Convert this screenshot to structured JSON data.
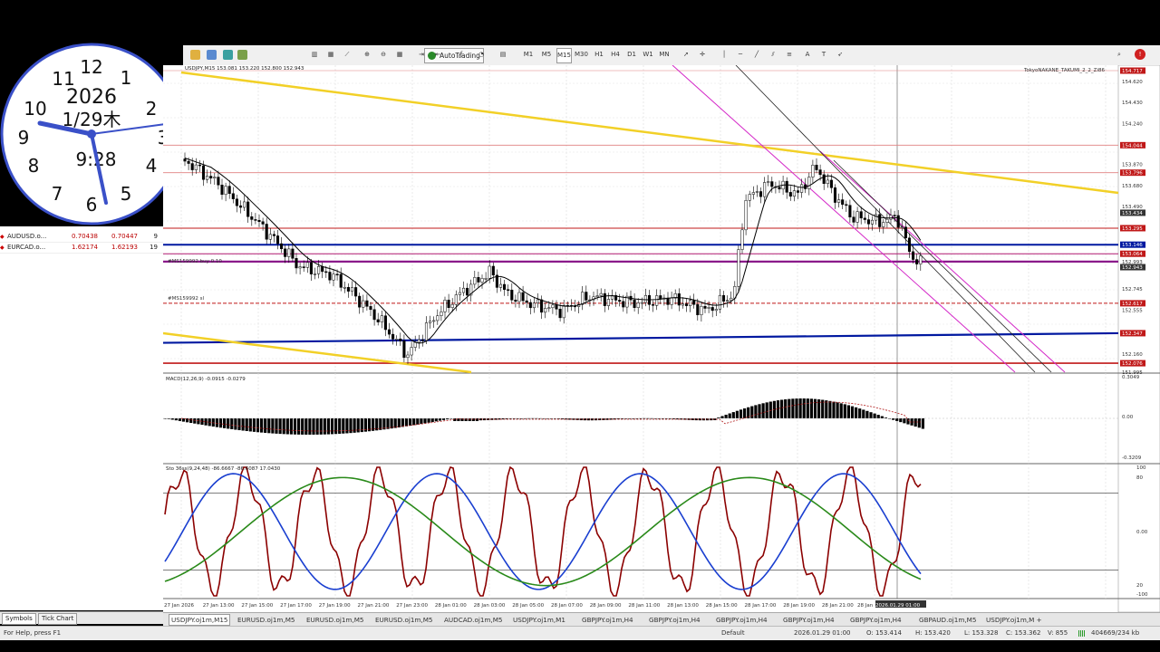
{
  "clock": {
    "year": "2026",
    "date": "1/29木",
    "time": "9:28",
    "numerals": [
      "12",
      "1",
      "2",
      "3",
      "4",
      "5",
      "6",
      "7",
      "8",
      "9",
      "10",
      "11"
    ]
  },
  "market_watch": {
    "rows": [
      {
        "symbol": "AUDUSD.o...",
        "bid": "0.70438",
        "ask": "0.70447",
        "spread": "9"
      },
      {
        "symbol": "EURCAD.o...",
        "bid": "1.62174",
        "ask": "1.62193",
        "spread": "19"
      }
    ],
    "tabs": [
      "Symbols",
      "Tick Chart"
    ]
  },
  "toolbar": {
    "autotrading_label": "AutoTrading",
    "timeframes": [
      "M1",
      "M5",
      "M15",
      "M30",
      "H1",
      "H4",
      "D1",
      "W1",
      "MN"
    ],
    "active_timeframe": "M15"
  },
  "chart": {
    "header": "USDJPY,M15 153.081 153.220 152.800 152.943",
    "top_right_label": "TokyoNAKANE_TAKUMI_2_2_Zi86",
    "hline_label_1": "#MS159992 buy 0.10",
    "hline_label_2": "#MS159992 sl",
    "price_scale": [
      "154.717",
      "154.620",
      "154.430",
      "154.240",
      "154.044",
      "153.870",
      "153.796",
      "153.680",
      "153.490",
      "153.434",
      "153.295",
      "153.146",
      "153.064",
      "152.993",
      "152.943",
      "152.745",
      "152.617",
      "152.555",
      "152.347",
      "152.160",
      "152.076",
      "151.995"
    ],
    "macd_label": "MACD(12,26,9) -0.0915 -0.0279",
    "macd_scale": [
      "0.3049",
      "0.00",
      "-0.3209"
    ],
    "stoch_label": "Sto 36ss(9,24,48) -86.6667 -86.6087 17.0430",
    "stoch_scale": [
      "100",
      "80",
      "0.00",
      "20",
      "-100"
    ],
    "time_axis": [
      "27 Jan 2026",
      "27 Jan 13:00",
      "27 Jan 15:00",
      "27 Jan 17:00",
      "27 Jan 19:00",
      "27 Jan 21:00",
      "27 Jan 23:00",
      "28 Jan 01:00",
      "28 Jan 03:00",
      "28 Jan 05:00",
      "28 Jan 07:00",
      "28 Jan 09:00",
      "28 Jan 11:00",
      "28 Jan 13:00",
      "28 Jan 15:00",
      "28 Jan 17:00",
      "28 Jan 19:00",
      "28 Jan 21:00",
      "28 Jan",
      "2026.01.29 01:00"
    ]
  },
  "chart_tabs": {
    "tabs": [
      "USDJPY.oj1m,M15",
      "EURUSD.oj1m,M5",
      "EURUSD.oj1m,M5",
      "EURUSD.oj1m,M5",
      "AUDCAD.oj1m,M5",
      "USDJPY.oj1m,M1",
      "GBPJPY.oj1m,H4",
      "GBPJPY.oj1m,H4",
      "GBPJPY.oj1m,H4",
      "GBPJPY.oj1m,H4",
      "GBPJPY.oj1m,H4",
      "GBPAUD.oj1m,M5",
      "USDJPY.oj1m,M +"
    ],
    "active_index": 0
  },
  "status": {
    "help": "For Help, press F1",
    "profile": "Default",
    "datetime": "2026.01.29 01:00",
    "open": "O: 153.414",
    "high": "H: 153.420",
    "low": "L: 153.328",
    "close": "C: 153.362",
    "volume": "V: 855",
    "traffic": "404669/234 kb"
  },
  "colors": {
    "bull_candle": "#ffffff",
    "bear_candle": "#000000",
    "trendline_yellow": "#f2d027",
    "channel_magenta": "#d428c8",
    "level_blue": "#0018a0",
    "level_red": "#c01818",
    "stoch_main": "#8b0000",
    "stoch_signal": "#1a3fd0",
    "stoch_slow": "#2a8a1a"
  }
}
